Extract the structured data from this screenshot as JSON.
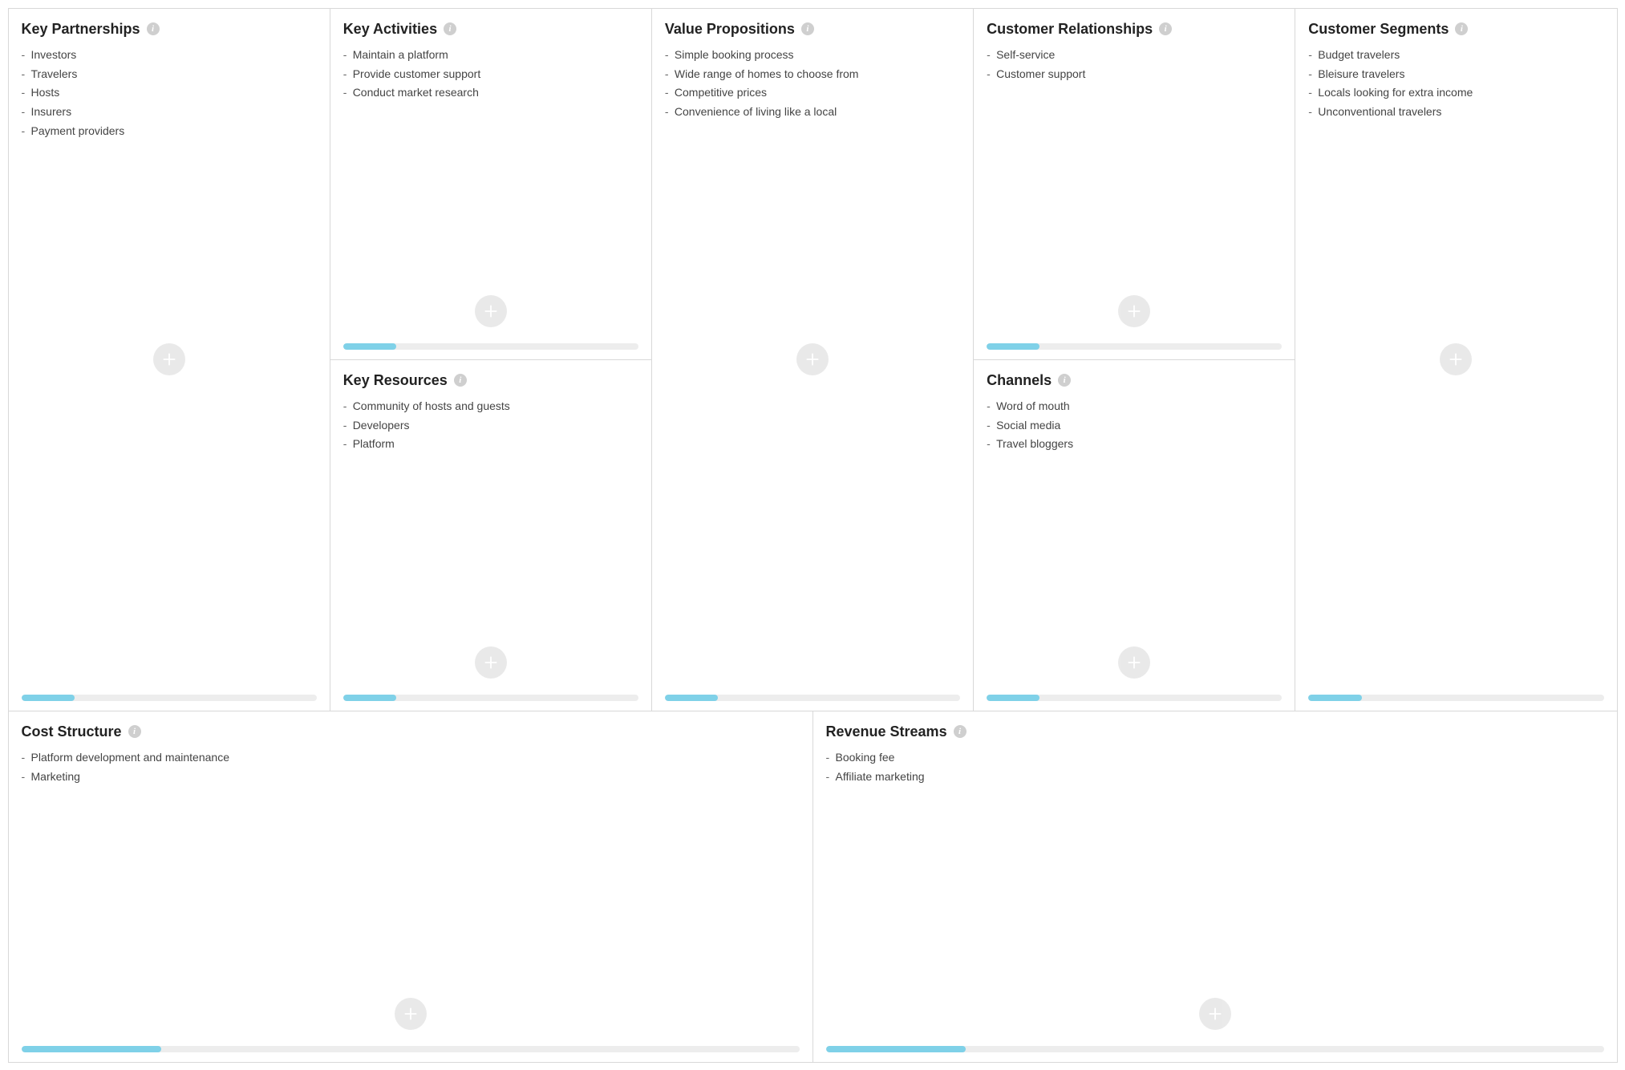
{
  "blocks": {
    "kp": {
      "title": "Key Partnerships",
      "items": [
        "Investors",
        "Travelers",
        "Hosts",
        "Insurers",
        "Payment providers"
      ],
      "progress": 18
    },
    "ka": {
      "title": "Key Activities",
      "items": [
        "Maintain a platform",
        "Provide customer support",
        "Conduct market research"
      ],
      "progress": 18
    },
    "kr": {
      "title": "Key Resources",
      "items": [
        "Community of hosts and guests",
        "Developers",
        "Platform"
      ],
      "progress": 18
    },
    "vp": {
      "title": "Value Propositions",
      "items": [
        "Simple booking process",
        "Wide range of homes to choose from",
        "Competitive prices",
        "Convenience of living like a local"
      ],
      "progress": 18
    },
    "cr": {
      "title": "Customer Relationships",
      "items": [
        "Self-service",
        "Customer support"
      ],
      "progress": 18
    },
    "ch": {
      "title": "Channels",
      "items": [
        "Word of mouth",
        "Social media",
        "Travel bloggers"
      ],
      "progress": 18
    },
    "cs": {
      "title": "Customer Segments",
      "items": [
        "Budget travelers",
        "Bleisure travelers",
        "Locals looking for extra income",
        "Unconventional travelers"
      ],
      "progress": 18
    },
    "cost": {
      "title": "Cost Structure",
      "items": [
        "Platform development and maintenance",
        "Marketing"
      ],
      "progress": 18
    },
    "rev": {
      "title": "Revenue Streams",
      "items": [
        "Booking fee",
        "Affiliate marketing"
      ],
      "progress": 18
    }
  },
  "colors": {
    "accent": "#7fd1e8",
    "iconGrey": "#cfcfcf",
    "addGrey": "#e6e6e6"
  }
}
